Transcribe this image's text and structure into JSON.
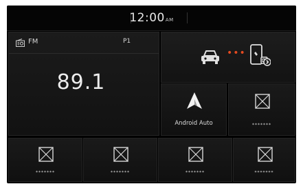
{
  "status_bar": {
    "time": "12:00",
    "ampm": "AM"
  },
  "radio": {
    "band": "FM",
    "preset": "P1",
    "frequency": "89.1",
    "icon": "radio-icon"
  },
  "phone_connect": {
    "icons": [
      "car-icon",
      "dots-icon",
      "phone-icon"
    ],
    "dot_color": "#e44a20"
  },
  "tiles": [
    {
      "label": "Android Auto",
      "icon": "android-auto-icon"
    },
    {
      "label": "*******",
      "icon": "placeholder-icon"
    },
    {
      "label": "*******",
      "icon": "placeholder-icon"
    },
    {
      "label": "*******",
      "icon": "placeholder-icon"
    },
    {
      "label": "*******",
      "icon": "placeholder-icon"
    },
    {
      "label": "*******",
      "icon": "placeholder-icon"
    }
  ]
}
